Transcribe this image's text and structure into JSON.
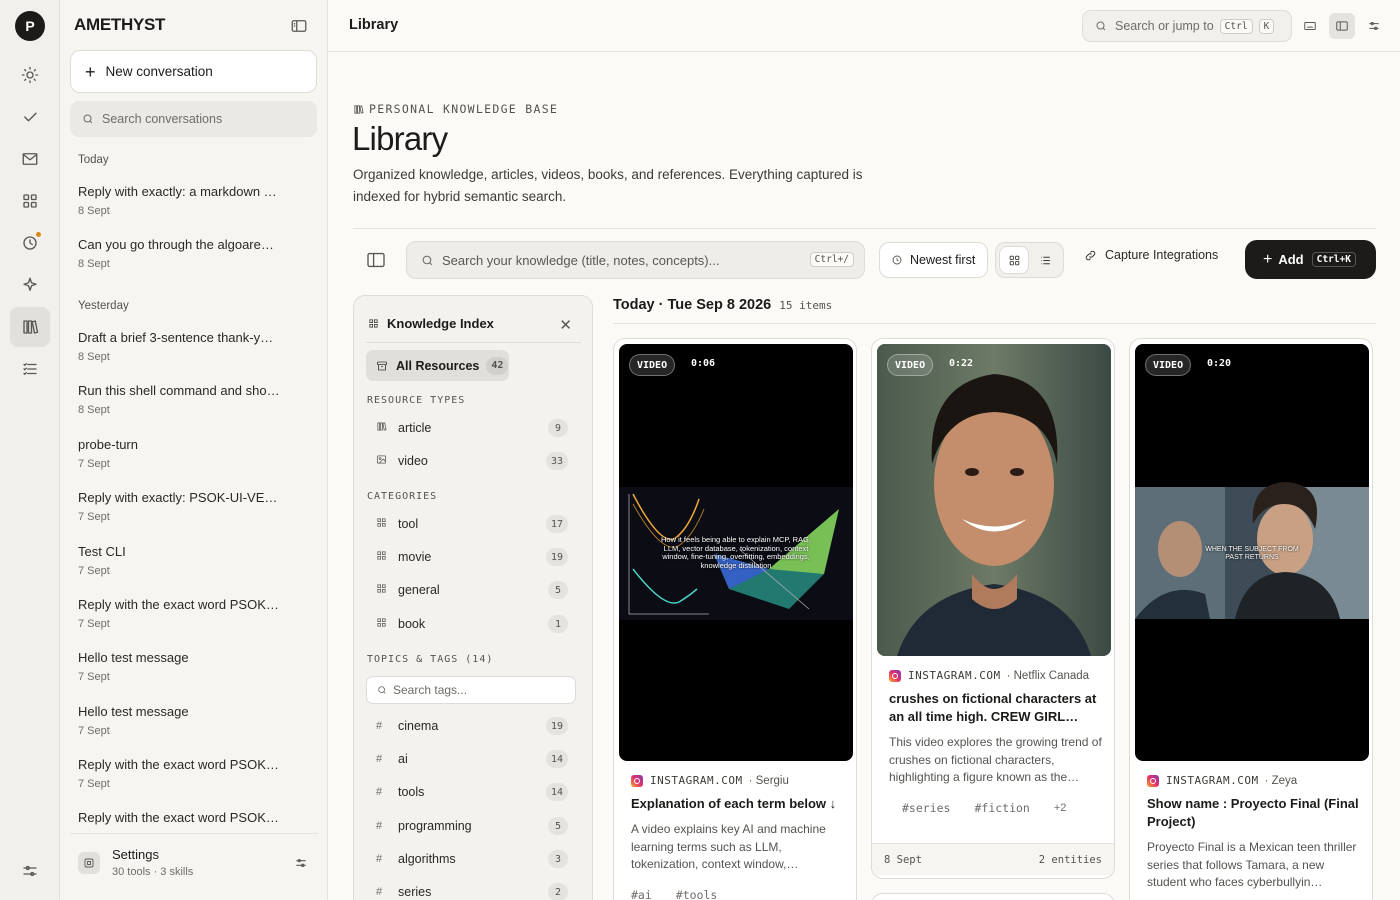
{
  "rail": {
    "logo": "P",
    "items": [
      "sun-icon",
      "check-icon",
      "mail-icon",
      "grid-icon",
      "clock-icon",
      "sparkle-icon",
      "library-icon",
      "list-icon"
    ],
    "active": "library-icon"
  },
  "sidebar": {
    "brand": "AMETHYST",
    "new_conversation": "New conversation",
    "search_placeholder": "Search conversations",
    "groups": [
      {
        "label": "Today",
        "items": [
          {
            "title": "Reply with exactly: a markdown …",
            "date": "8 Sept"
          },
          {
            "title": "Can you go through the algoare…",
            "date": "8 Sept"
          }
        ]
      },
      {
        "label": "Yesterday",
        "items": [
          {
            "title": "Draft a brief 3-sentence thank-y…",
            "date": "8 Sept"
          },
          {
            "title": "Run this shell command and sho…",
            "date": "8 Sept"
          },
          {
            "title": "probe-turn",
            "date": "7 Sept"
          },
          {
            "title": "Reply with exactly: PSOK-UI-VE…",
            "date": "7 Sept"
          },
          {
            "title": "Test CLI",
            "date": "7 Sept"
          },
          {
            "title": "Reply with the exact word PSOK…",
            "date": "7 Sept"
          },
          {
            "title": "Hello test message",
            "date": "7 Sept"
          },
          {
            "title": "Hello test message",
            "date": "7 Sept"
          },
          {
            "title": "Reply with the exact word PSOK…",
            "date": "7 Sept"
          },
          {
            "title": "Reply with the exact word PSOK…",
            "date": ""
          }
        ]
      }
    ],
    "settings": {
      "title": "Settings",
      "subtitle": "30 tools · 3 skills"
    }
  },
  "topbar": {
    "title": "Library",
    "jump_placeholder": "Search or jump to",
    "jump_kbd": [
      "Ctrl",
      "K"
    ]
  },
  "header": {
    "eyebrow": "PERSONAL KNOWLEDGE BASE",
    "title": "Library",
    "description": "Organized knowledge, articles, videos, books, and references. Everything captured is indexed for hybrid semantic search."
  },
  "toolbar": {
    "search_placeholder": "Search your knowledge (title, notes, concepts)...",
    "search_kbd": "Ctrl+/",
    "sort": "Newest first",
    "capture": "Capture Integrations",
    "add": "Add",
    "add_kbd": "Ctrl+K"
  },
  "knowledge_index": {
    "title": "Knowledge Index",
    "all": {
      "label": "All Resources",
      "count": "42"
    },
    "resource_types_label": "RESOURCE TYPES",
    "resource_types": [
      {
        "label": "article",
        "count": "9",
        "icon": "article-icon"
      },
      {
        "label": "video",
        "count": "33",
        "icon": "image-icon"
      }
    ],
    "categories_label": "CATEGORIES",
    "categories": [
      {
        "label": "tool",
        "count": "17"
      },
      {
        "label": "movie",
        "count": "19"
      },
      {
        "label": "general",
        "count": "5"
      },
      {
        "label": "book",
        "count": "1"
      }
    ],
    "tags_label": "TOPICS & TAGS (14)",
    "tag_search_placeholder": "Search tags...",
    "tags": [
      {
        "label": "cinema",
        "count": "19"
      },
      {
        "label": "ai",
        "count": "14"
      },
      {
        "label": "tools",
        "count": "14"
      },
      {
        "label": "programming",
        "count": "5"
      },
      {
        "label": "algorithms",
        "count": "3"
      },
      {
        "label": "series",
        "count": "2"
      }
    ]
  },
  "feed": {
    "heading": "Today · Tue Sep 8 2026",
    "count": "15 items",
    "cards": [
      {
        "badge": "VIDEO",
        "duration": "0:06",
        "overlay": "How it feels being able to explain MCP, RAG, LLM, vector database, tokenization, context window, fine-tuning, overfitting, embeddings, knowledge distillation",
        "source": "INSTAGRAM.COM",
        "author": "Sergiu",
        "title": "Explanation of each term below ↓",
        "description": "A video explains key AI and machine learning terms such as LLM, tokenization, context window,…",
        "tags": [
          "#ai",
          "#tools"
        ]
      },
      {
        "badge": "VIDEO",
        "duration": "0:22",
        "source": "INSTAGRAM.COM",
        "author": "Netflix Canada",
        "title": "crushes on fictional characters at an all time high. CREW GIRL…",
        "description": "This video explores the growing trend of crushes on fictional characters, highlighting a figure known as the…",
        "tags": [
          "#series",
          "#fiction"
        ],
        "more": "+2",
        "date": "8 Sept",
        "entities": "2 entities"
      },
      {
        "badge": "VIDEO",
        "duration": "0:20",
        "overlay": "WHEN THE SUBJECT FROM PAST RETURNS",
        "source": "INSTAGRAM.COM",
        "author": "Zeya",
        "title": "Show name : Proyecto Final (Final Project)",
        "description": "Proyecto Final is a Mexican teen thriller series that follows Tamara, a new student who faces cyberbullyin…"
      }
    ]
  }
}
